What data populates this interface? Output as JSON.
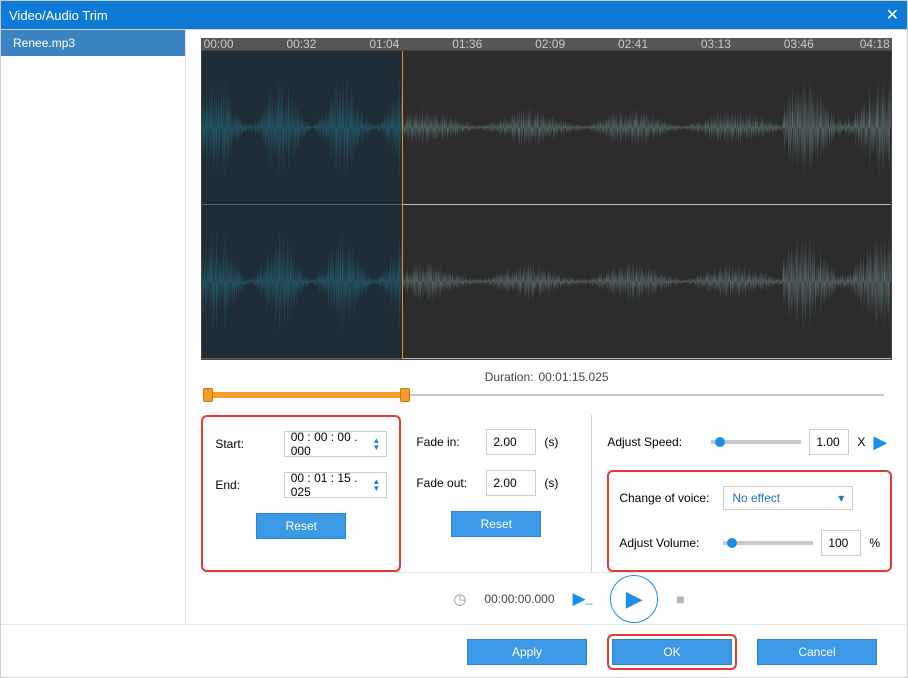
{
  "titlebar": {
    "title": "Video/Audio Trim"
  },
  "sidebar": {
    "file": "Renee.mp3"
  },
  "ruler": [
    "00:00",
    "00:32",
    "01:04",
    "01:36",
    "02:09",
    "02:41",
    "03:13",
    "03:46",
    "04:18"
  ],
  "duration": {
    "label": "Duration:",
    "value": "00:01:15.025"
  },
  "startend": {
    "start": {
      "label": "Start:",
      "value": "00 : 00 : 00 . 000"
    },
    "end": {
      "label": "End:",
      "value": "00 : 01 : 15 . 025"
    },
    "reset": "Reset"
  },
  "fade": {
    "in": {
      "label": "Fade in:",
      "value": "2.00",
      "unit": "(s)"
    },
    "out": {
      "label": "Fade out:",
      "value": "2.00",
      "unit": "(s)"
    },
    "reset": "Reset"
  },
  "right": {
    "speed": {
      "label": "Adjust Speed:",
      "value": "1.00",
      "x": "X"
    },
    "voice": {
      "label": "Change of voice:",
      "value": "No effect"
    },
    "volume": {
      "label": "Adjust Volume:",
      "value": "100",
      "unit": "%"
    }
  },
  "playbar": {
    "time": "00:00:00.000"
  },
  "footer": {
    "apply": "Apply",
    "ok": "OK",
    "cancel": "Cancel"
  }
}
